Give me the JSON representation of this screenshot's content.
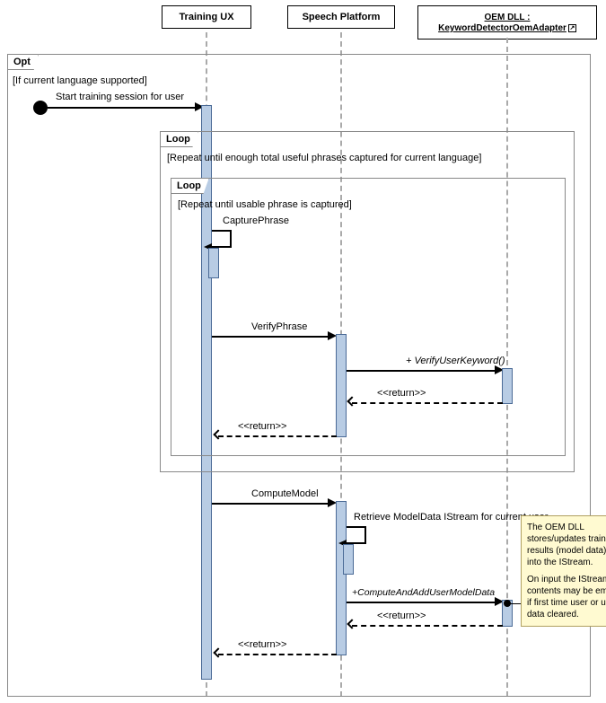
{
  "participants": {
    "trainingUX": "Training UX",
    "speechPlatform": "Speech Platform",
    "oemDll_top": "OEM DLL :",
    "oemDll_bottom": "KeywordDetectorOemAdapter"
  },
  "frames": {
    "opt": {
      "label": "Opt",
      "guard": "[If current language supported]"
    },
    "loop_outer": {
      "label": "Loop",
      "guard": "[Repeat until enough total useful phrases captured for current language]"
    },
    "loop_inner": {
      "label": "Loop",
      "guard": "[Repeat until usable phrase is captured]"
    }
  },
  "messages": {
    "startTraining": "Start training session for user",
    "capturePhrase": "CapturePhrase",
    "verifyPhrase": "VerifyPhrase",
    "verifyUserKeyword": "+ VerifyUserKeyword()",
    "return": "<<return>>",
    "computeModel": "ComputeModel",
    "retrieveModelData": "Retrieve ModelData IStream for current user",
    "computeAndAdd": "+ComputeAndAddUserModelData"
  },
  "note": {
    "p1": "The OEM DLL stores/updates training results (model data) into the IStream.",
    "p2": "On input the IStream contents may be empty if first time user or user data cleared."
  }
}
